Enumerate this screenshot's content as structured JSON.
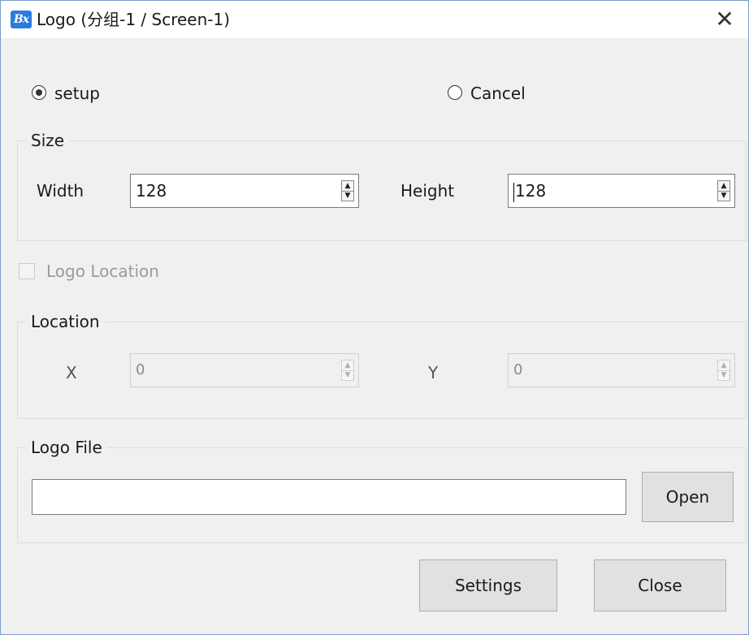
{
  "window": {
    "app_icon": "Bx",
    "title": "Logo  (分组-1 / Screen-1)",
    "close_glyph": "✕"
  },
  "mode": {
    "setup_label": "setup",
    "setup_checked": true,
    "cancel_label": "Cancel",
    "cancel_checked": false
  },
  "size_group": {
    "title": "Size",
    "width_label": "Width",
    "width_value": "128",
    "height_label": "Height",
    "height_value": "128"
  },
  "logo_location": {
    "label": "Logo Location",
    "checked": false,
    "enabled": false
  },
  "location_group": {
    "title": "Location",
    "x_label": "X",
    "x_value": "0",
    "y_label": "Y",
    "y_value": "0"
  },
  "logo_file_group": {
    "title": "Logo File",
    "path_value": "",
    "open_label": "Open"
  },
  "footer": {
    "settings_label": "Settings",
    "close_label": "Close"
  },
  "icons": {
    "spin_up": "▲",
    "spin_down": "▼"
  }
}
